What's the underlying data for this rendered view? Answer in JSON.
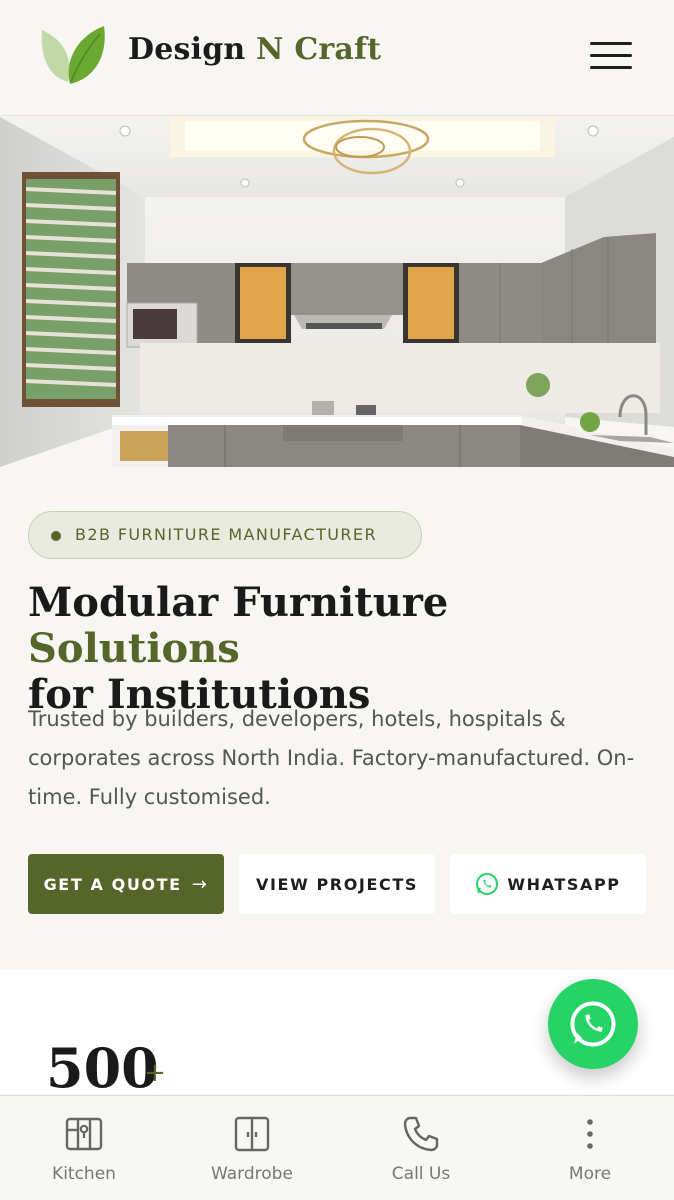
{
  "header": {
    "brand_part1": "Design",
    "brand_part2": "N Craft",
    "menu_icon": "hamburger-menu-icon",
    "logo_icon": "leaf-logo-icon"
  },
  "hero": {
    "image_subject": "modular-kitchen-photo"
  },
  "intro": {
    "badge": "B2B FURNITURE MANUFACTURER",
    "headline_part1": "Modular Furniture ",
    "headline_accent": "Solutions",
    "headline_part2": "for Institutions",
    "lead": "Trusted by builders, developers, hotels, hospitals & corporates across North India. Factory-manufactured. On-time. Fully customised."
  },
  "buttons": {
    "quote": "GET A QUOTE",
    "quote_arrow": "→",
    "projects": "VIEW PROJECTS",
    "whatsapp": "WHATSAPP"
  },
  "stats": {
    "number": "500",
    "suffix": "+"
  },
  "bottom_nav": {
    "items": [
      {
        "label": "Kitchen",
        "icon": "kitchen-cabinet-icon"
      },
      {
        "label": "Wardrobe",
        "icon": "wardrobe-icon"
      },
      {
        "label": "Call Us",
        "icon": "phone-icon"
      },
      {
        "label": "More",
        "icon": "more-vertical-icon"
      }
    ]
  },
  "colors": {
    "brand_green": "#56652a",
    "background": "#f7f6f2",
    "whatsapp": "#25d366"
  }
}
